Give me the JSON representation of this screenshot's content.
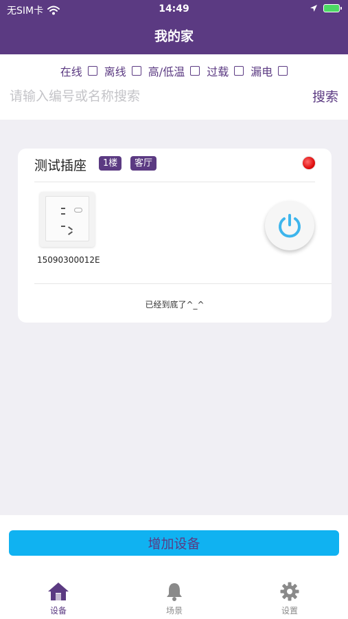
{
  "status_bar": {
    "carrier": "无SIM卡",
    "time": "14:49"
  },
  "header": {
    "title": "我的家"
  },
  "filters": [
    {
      "label": "在线"
    },
    {
      "label": "离线"
    },
    {
      "label": "高/低温"
    },
    {
      "label": "过载"
    },
    {
      "label": "漏电"
    }
  ],
  "search": {
    "placeholder": "请输入编号或名称搜索",
    "value": "",
    "button_label": "搜索"
  },
  "device": {
    "name": "测试插座",
    "floor_tag": "1楼",
    "room_tag": "客厅",
    "id": "15090300012E",
    "status_color": "#e01010"
  },
  "list_end_text": "已经到底了^_^",
  "add_button_label": "增加设备",
  "tabs": [
    {
      "label": "设备",
      "icon": "home-icon",
      "active": true
    },
    {
      "label": "场景",
      "icon": "bell-icon",
      "active": false
    },
    {
      "label": "设置",
      "icon": "gear-icon",
      "active": false
    }
  ],
  "colors": {
    "primary": "#5b3a82",
    "accent": "#10b2f1",
    "inactive": "#8a8a8a"
  }
}
